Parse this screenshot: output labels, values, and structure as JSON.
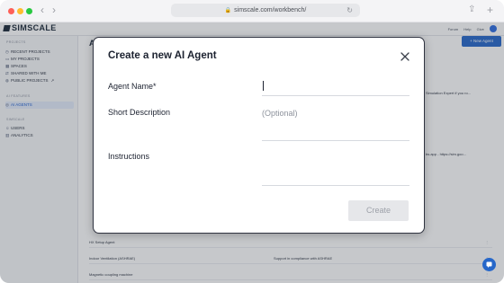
{
  "browser": {
    "url": "simscale.com/workbench/",
    "back_icon": "chevron-left-icon",
    "forward_icon": "chevron-right-icon",
    "lock_icon": "lock-icon",
    "reload_icon": "reload-icon",
    "share_icon": "share-icon",
    "new_tab_icon": "plus-icon"
  },
  "app": {
    "logo_text": "SIMSCALE",
    "header_links": [
      "Forum",
      "Help",
      "Give"
    ],
    "new_agent_label": "+ New Agent",
    "page_title_fragment": "AI"
  },
  "sidebar": {
    "sections": [
      {
        "heading": "PROJECTS",
        "items": [
          "RECENT PROJECTS",
          "MY PROJECTS",
          "SPACES",
          "SHARED WITH ME",
          "PUBLIC PROJECTS"
        ]
      },
      {
        "heading": "AI FEATURES",
        "items": [
          "AI AGENTS"
        ]
      },
      {
        "heading": "SIMSCALE",
        "items": [
          "USERS",
          "ANALYTICS"
        ]
      }
    ],
    "active_item": "AI AGENTS"
  },
  "background_list": {
    "visible_fragments": [
      "Simulation Expert if you ro...",
      "bs.app - https://sim.goo..."
    ],
    "rows": [
      {
        "name": "HX Setup Agent",
        "description": ""
      },
      {
        "name": "Indoor Ventilation (ASHRAE)",
        "description": "Support in compliance with ASHRAE"
      },
      {
        "name": "Magnetic coupling machine",
        "description": ""
      }
    ]
  },
  "modal": {
    "title": "Create a new AI Agent",
    "close_icon": "close-icon",
    "fields": {
      "name_label": "Agent Name",
      "name_required_mark": "*",
      "name_value": "",
      "description_label": "Short Description",
      "description_placeholder": "(Optional)",
      "instructions_label": "Instructions",
      "instructions_value": ""
    },
    "create_label": "Create",
    "create_enabled": false
  },
  "chat_icon": "chat-bubble-icon",
  "colors": {
    "accent": "#2667c9",
    "active_sidebar_bg": "#e4ecfb",
    "disabled_button_bg": "#e6e7ea"
  }
}
